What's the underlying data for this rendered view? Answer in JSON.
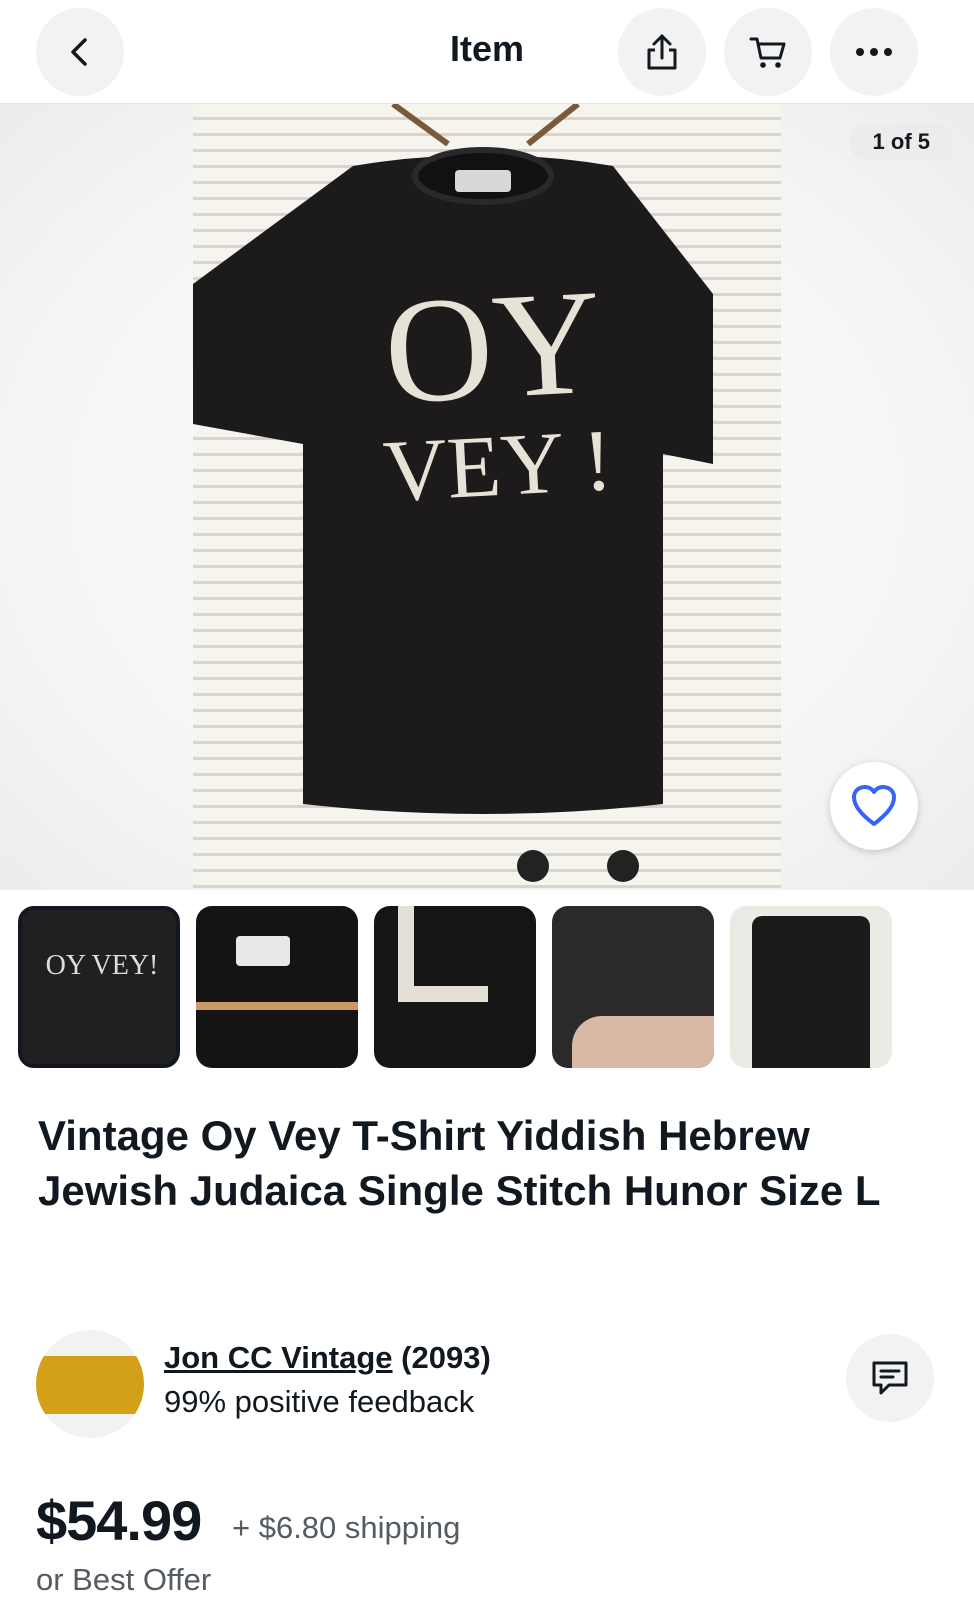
{
  "header": {
    "title": "Item",
    "back_icon": "chevron-left-icon",
    "share_icon": "share-icon",
    "cart_icon": "cart-icon",
    "more_icon": "more-dots-icon"
  },
  "gallery": {
    "counter": "1 of 5",
    "favorite_icon": "heart-icon",
    "shirt_text_line1": "OY",
    "shirt_text_line2": "VEY !",
    "thumbnails": [
      {
        "label": "OY VEY!",
        "selected": true
      },
      {
        "label": "tag",
        "selected": false
      },
      {
        "label": "print detail",
        "selected": false
      },
      {
        "label": "hem stitch",
        "selected": false
      },
      {
        "label": "back",
        "selected": false
      }
    ]
  },
  "listing": {
    "title": "Vintage Oy Vey T-Shirt Yiddish Hebrew Jewish Judaica Single Stitch Hunor Size L"
  },
  "seller": {
    "name": "Jon CC Vintage",
    "count": "(2093)",
    "feedback": "99% positive feedback",
    "message_icon": "message-icon"
  },
  "pricing": {
    "price": "$54.99",
    "shipping": "+ $6.80 shipping",
    "offer": "or Best Offer"
  },
  "colors": {
    "accent_gold": "#d4a017",
    "text_primary": "#111820",
    "text_secondary": "#555b62",
    "heart_blue": "#3665f3"
  }
}
